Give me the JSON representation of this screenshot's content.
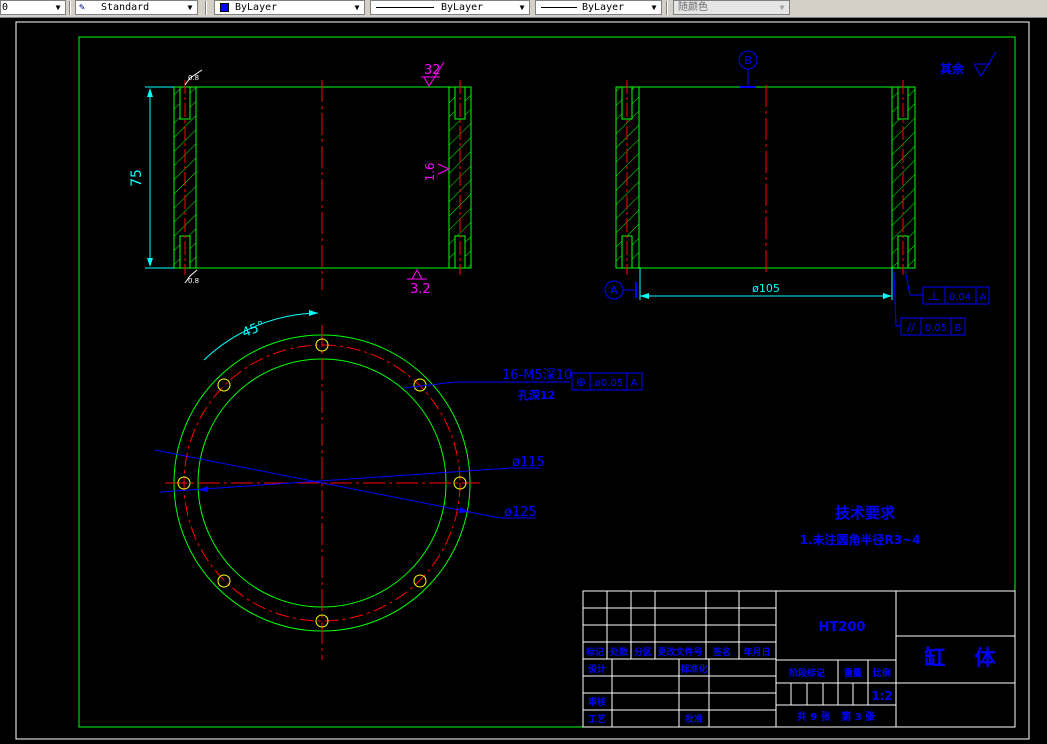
{
  "toolbar": {
    "layer_value": "0",
    "text_style": "Standard",
    "color": "ByLayer",
    "color_swatch": "#0000ff",
    "linetype": "ByLayer",
    "lineweight": "ByLayer",
    "plot_style": "随颜色"
  },
  "drawing": {
    "dims": {
      "height_75": "75",
      "rough_32_top": "32",
      "rough_16": "1.6",
      "rough_32_bottom": "3.2",
      "angle_45": "45°",
      "dia_105": "ø105",
      "hole_callout_1": "16-M5深10",
      "hole_callout_2": "孔深12",
      "dia_115": "ø115",
      "dia_125": "ø125",
      "small_08_a": "0.8",
      "small_08_b": "0.8"
    },
    "datums": {
      "A": "A",
      "B": "B"
    },
    "tolerances": {
      "perpendicularity": {
        "symbol": "⊥",
        "value": "0.04",
        "datum": "A"
      },
      "parallelism": {
        "symbol": "//",
        "value": "0.05",
        "datum": "B"
      },
      "position": {
        "symbol": "⊕",
        "value": "ø0.05",
        "datum": "A"
      }
    },
    "rest_finish": "其余",
    "tech_req": {
      "title": "技术要求",
      "line1": "1.未注圆角半径R3~4"
    },
    "title_block": {
      "material": "HT200",
      "part_name": "缸    体",
      "scale": "1:2",
      "col_labels": [
        "标记",
        "处数",
        "分区",
        "更改文件号",
        "签名",
        "年月日"
      ],
      "row_labels": [
        "设计",
        "审核",
        "工艺"
      ],
      "std": "标准化",
      "approve": "批准",
      "stage_labels": [
        "阶段标记",
        "重量",
        "比例"
      ],
      "sheets": "共 9 张   第 3 张"
    }
  },
  "colors": {
    "background": "#000000",
    "frame": "#00ff00",
    "outline": "#00ff00",
    "centerline": "#ff0000",
    "dimension": "#00ffff",
    "annotation": "#0000ff",
    "roughness": "#ff00ff",
    "text_white": "#ffffff"
  }
}
